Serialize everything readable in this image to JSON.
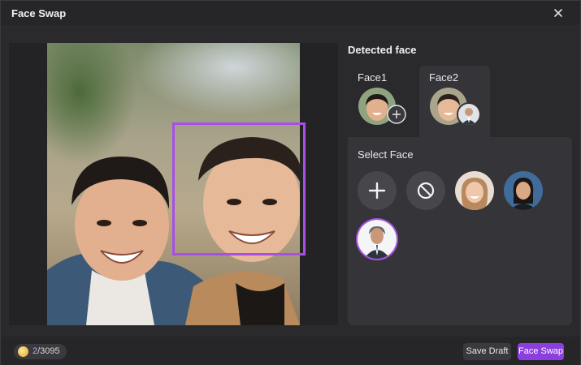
{
  "dialog": {
    "title": "Face Swap"
  },
  "detected": {
    "title": "Detected face",
    "faces": [
      {
        "label": "Face1"
      },
      {
        "label": "Face2"
      }
    ]
  },
  "select_face": {
    "title": "Select Face",
    "options": [
      "add-face",
      "no-face",
      "woman-smiling-preset",
      "woman-office-preset",
      "man-suit-preset"
    ]
  },
  "footer": {
    "credits_used": "2",
    "credits_total": "/3095",
    "save_draft_label": "Save Draft",
    "face_swap_label": "Face Swap"
  },
  "colors": {
    "accent": "#a84fe6",
    "primary_button": "#8b3fe0",
    "panel": "#353539",
    "background": "#2a2a2d"
  }
}
